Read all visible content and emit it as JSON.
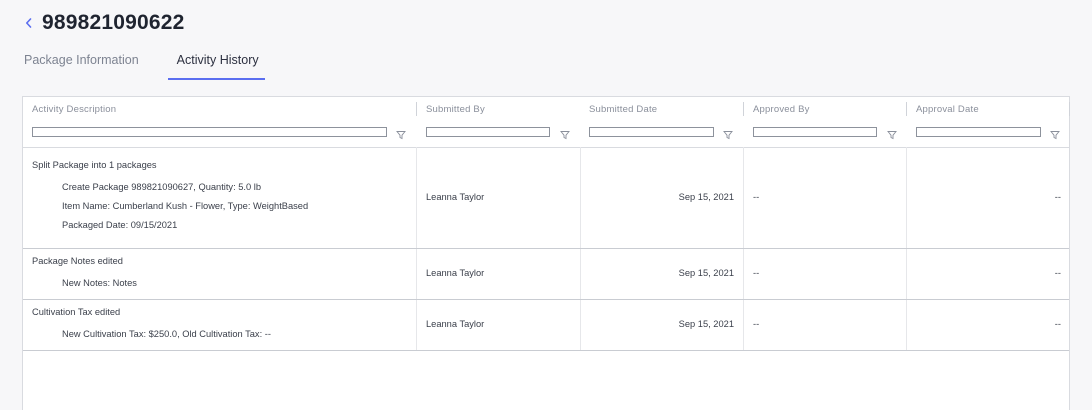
{
  "header": {
    "back_icon": "chevron-left-icon",
    "title": "989821090622"
  },
  "tabs": [
    {
      "label": "Package Information",
      "active": false
    },
    {
      "label": "Activity History",
      "active": true
    }
  ],
  "colors": {
    "accent": "#5b6ef0",
    "title": "#1f2430",
    "muted": "#8a8f9b"
  },
  "table": {
    "columns": [
      {
        "label": "Activity Description",
        "filter_icon": "filter-icon"
      },
      {
        "label": "Submitted By",
        "filter_icon": "filter-icon"
      },
      {
        "label": "Submitted Date",
        "filter_icon": "filter-icon"
      },
      {
        "label": "Approved By",
        "filter_icon": "filter-icon"
      },
      {
        "label": "Approval Date",
        "filter_icon": "filter-icon"
      }
    ],
    "rows": [
      {
        "description": "Split Package into 1 packages",
        "details": [
          "Create Package 989821090627, Quantity: 5.0 lb",
          "Item Name: Cumberland Kush - Flower, Type: WeightBased",
          "Packaged Date: 09/15/2021"
        ],
        "submitted_by": "Leanna Taylor",
        "submitted_date": "Sep 15, 2021",
        "approved_by": "--",
        "approval_date": "--"
      },
      {
        "description": "Package Notes edited",
        "details": [
          "New Notes: Notes"
        ],
        "submitted_by": "Leanna Taylor",
        "submitted_date": "Sep 15, 2021",
        "approved_by": "--",
        "approval_date": "--"
      },
      {
        "description": "Cultivation Tax edited",
        "details": [
          "New Cultivation Tax: $250.0, Old Cultivation Tax: --"
        ],
        "submitted_by": "Leanna Taylor",
        "submitted_date": "Sep 15, 2021",
        "approved_by": "--",
        "approval_date": "--"
      }
    ]
  }
}
